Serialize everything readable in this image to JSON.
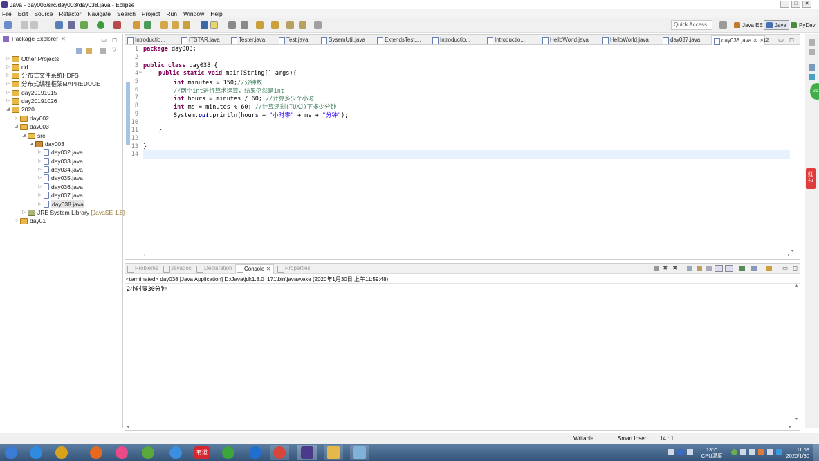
{
  "window": {
    "title": "Java - day003/src/day003/day038.java - Eclipse"
  },
  "menu": [
    "File",
    "Edit",
    "Source",
    "Refactor",
    "Navigate",
    "Search",
    "Project",
    "Run",
    "Window",
    "Help"
  ],
  "quick_access": {
    "placeholder": "Quick Access"
  },
  "perspectives": [
    {
      "label": "Java EE",
      "color": "#c07a2c"
    },
    {
      "label": "Java",
      "color": "#4a6fb0",
      "active": true
    },
    {
      "label": "PyDev",
      "color": "#4b8b3b"
    }
  ],
  "package_explorer": {
    "title": "Package Explorer",
    "items": [
      {
        "label": "Other Projects",
        "icon": "folder-icon"
      },
      {
        "label": "dd",
        "icon": "project-icon"
      },
      {
        "label": "分布式文件系统HDFS",
        "icon": "project-icon"
      },
      {
        "label": "分布式编程框架MAPREDUCE",
        "icon": "project-icon"
      },
      {
        "label": "day20191015",
        "icon": "project-icon"
      },
      {
        "label": "day20191026",
        "icon": "project-icon"
      },
      {
        "label": "2020",
        "icon": "project-icon"
      },
      {
        "label": "day002",
        "icon": "project-icon"
      },
      {
        "label": "day003",
        "icon": "project-icon"
      },
      {
        "label": "src",
        "icon": "source-folder-icon"
      },
      {
        "label": "day003",
        "icon": "package-icon"
      },
      {
        "label": "day032.java",
        "icon": "java-file-icon"
      },
      {
        "label": "day033.java",
        "icon": "java-file-icon"
      },
      {
        "label": "day034.java",
        "icon": "java-file-icon"
      },
      {
        "label": "day035.java",
        "icon": "java-file-icon"
      },
      {
        "label": "day036.java",
        "icon": "java-file-icon"
      },
      {
        "label": "day037.java",
        "icon": "java-file-icon"
      },
      {
        "label": "day038.java",
        "icon": "java-file-icon"
      },
      {
        "label": "JRE System Library",
        "icon": "library-icon",
        "suffix": "[JavaSE-1.8]"
      },
      {
        "label": "day01",
        "icon": "project-icon"
      }
    ]
  },
  "editor_tabs": [
    "Introductio...",
    "ITSTAR.java",
    "Tester.java",
    "Test.java",
    "SysemUtil.java",
    "ExtendsTest....",
    "Introductio...",
    "Introductio...",
    "HelloWorld.java",
    "HelloWorld.java",
    "day037.java",
    "day038.java"
  ],
  "editor_tabs_more": "»12",
  "code_lines": [
    "1",
    "2",
    "3",
    "4",
    "5",
    "6",
    "7",
    "8",
    "9",
    "10",
    "11",
    "12",
    "13",
    "14"
  ],
  "code": {
    "l1_kw": "package",
    "l1_rest": " day003;",
    "l3_kw": "public class",
    "l3_rest": " day038 {",
    "l4_kw": "public static void",
    "l4_rest": " main(String[] args){",
    "l5_kw": "int",
    "l5_rest": " minutes = 150;",
    "l5_cm": "//分钟数",
    "l6_cm": "//两个int进行算术运算，结果仍然是int",
    "l7_kw": "int",
    "l7_rest": " hours = minutes / 60; ",
    "l7_cm": "//计算多少个小时",
    "l8_kw": "int",
    "l8_rest": " ms = minutes % 60; ",
    "l8_cm": "//计算还剩(TUXJ)下多少分钟",
    "l9_a": "System.",
    "l9_out": "out",
    "l9_b": ".println(hours + ",
    "l9_s1": "\"小时零\"",
    "l9_c": " + ms + ",
    "l9_s2": "\"分钟\"",
    "l9_d": ");",
    "l11": "}",
    "l13": "}"
  },
  "console": {
    "tabs": [
      "Problems",
      "Javadoc",
      "Declaration",
      "Console",
      "Properties"
    ],
    "active": "Console",
    "terminated": "<terminated> day038 [Java Application] D:\\Java\\jdk1.8.0_171\\bin\\javaw.exe (2020年1月30日 上午11:59:48)",
    "output": "2小时零30分钟"
  },
  "status": {
    "writable": "Writable",
    "insert": "Smart Insert",
    "position": "14 : 1"
  },
  "taskbar": {
    "apps": [
      {
        "name": "start-icon",
        "color": "#3a7bd5"
      },
      {
        "name": "ie-icon",
        "color": "#2e8be0"
      },
      {
        "name": "pinwheel-icon",
        "color": "#d9a21b"
      },
      {
        "name": "firefox-icon",
        "color": "#e56a1f"
      },
      {
        "name": "flower-icon",
        "color": "#e94b8a"
      },
      {
        "name": "chrome-green-icon",
        "color": "#58a83a"
      },
      {
        "name": "cloud-icon",
        "color": "#3a8fe0"
      },
      {
        "name": "youdao-icon",
        "color": "#d7262d",
        "label": "有道"
      },
      {
        "name": "360-icon",
        "color": "#3ba63b"
      },
      {
        "name": "ie2-icon",
        "color": "#1f6fd1"
      },
      {
        "name": "chrome-icon",
        "color": "#d8453a"
      },
      {
        "name": "eclipse-icon",
        "color": "#4b3a8c"
      },
      {
        "name": "explorer-icon",
        "color": "#e5b84a"
      },
      {
        "name": "notepad-icon",
        "color": "#7fb1d9"
      }
    ],
    "temp": "13°C",
    "cpu": "CPU温度",
    "time": "11:59",
    "date": "2020/1/30"
  },
  "side_badge": "红包",
  "green_badge": "26"
}
